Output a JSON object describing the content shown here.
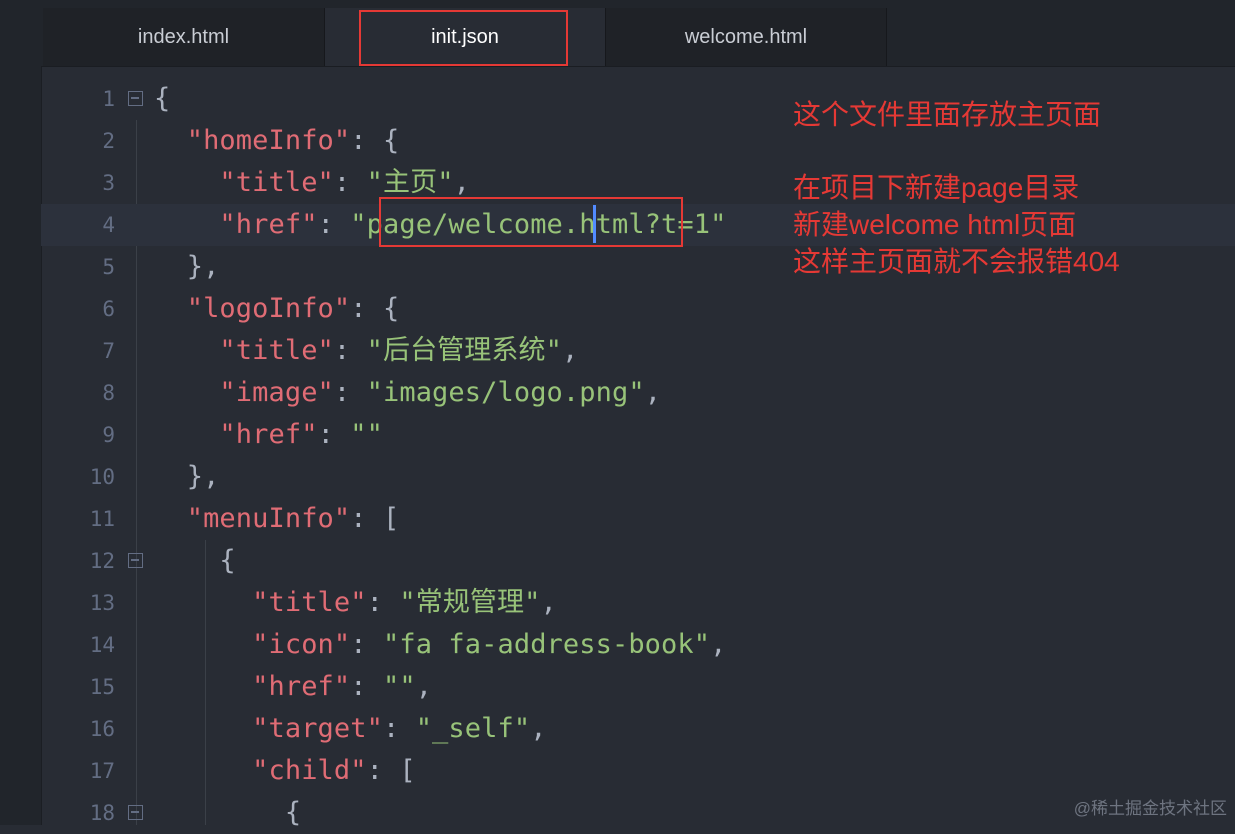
{
  "tabs": [
    {
      "label": "index.html"
    },
    {
      "label": "init.json"
    },
    {
      "label": "welcome.html"
    }
  ],
  "lines": [
    {
      "num": "1"
    },
    {
      "num": "2"
    },
    {
      "num": "3"
    },
    {
      "num": "4"
    },
    {
      "num": "5"
    },
    {
      "num": "6"
    },
    {
      "num": "7"
    },
    {
      "num": "8"
    },
    {
      "num": "9"
    },
    {
      "num": "10"
    },
    {
      "num": "11"
    },
    {
      "num": "12"
    },
    {
      "num": "13"
    },
    {
      "num": "14"
    },
    {
      "num": "15"
    },
    {
      "num": "16"
    },
    {
      "num": "17"
    },
    {
      "num": "18"
    }
  ],
  "code": {
    "homeInfo_key": "\"homeInfo\"",
    "title_key": "\"title\"",
    "home_title_val": "\"主页\"",
    "href_key": "\"href\"",
    "home_href_val": "\"page/welcome.html?t=1\"",
    "logoInfo_key": "\"logoInfo\"",
    "logo_title_val": "\"后台管理系统\"",
    "image_key": "\"image\"",
    "logo_image_val": "\"images/logo.png\"",
    "empty_val": "\"\"",
    "menuInfo_key": "\"menuInfo\"",
    "menu_title_val": "\"常规管理\"",
    "icon_key": "\"icon\"",
    "menu_icon_val": "\"fa fa-address-book\"",
    "target_key": "\"target\"",
    "menu_target_val": "\"_self\"",
    "child_key": "\"child\""
  },
  "annotations": {
    "line1": "这个文件里面存放主页面",
    "line2": "在项目下新建page目录",
    "line3": "新建welcome html页面",
    "line4": "这样主页面就不会报错404"
  },
  "watermark": "@稀土掘金技术社区",
  "colors": {
    "background": "#282c34",
    "key": "#e06c75",
    "string": "#98c379",
    "annotation": "#e53935"
  }
}
